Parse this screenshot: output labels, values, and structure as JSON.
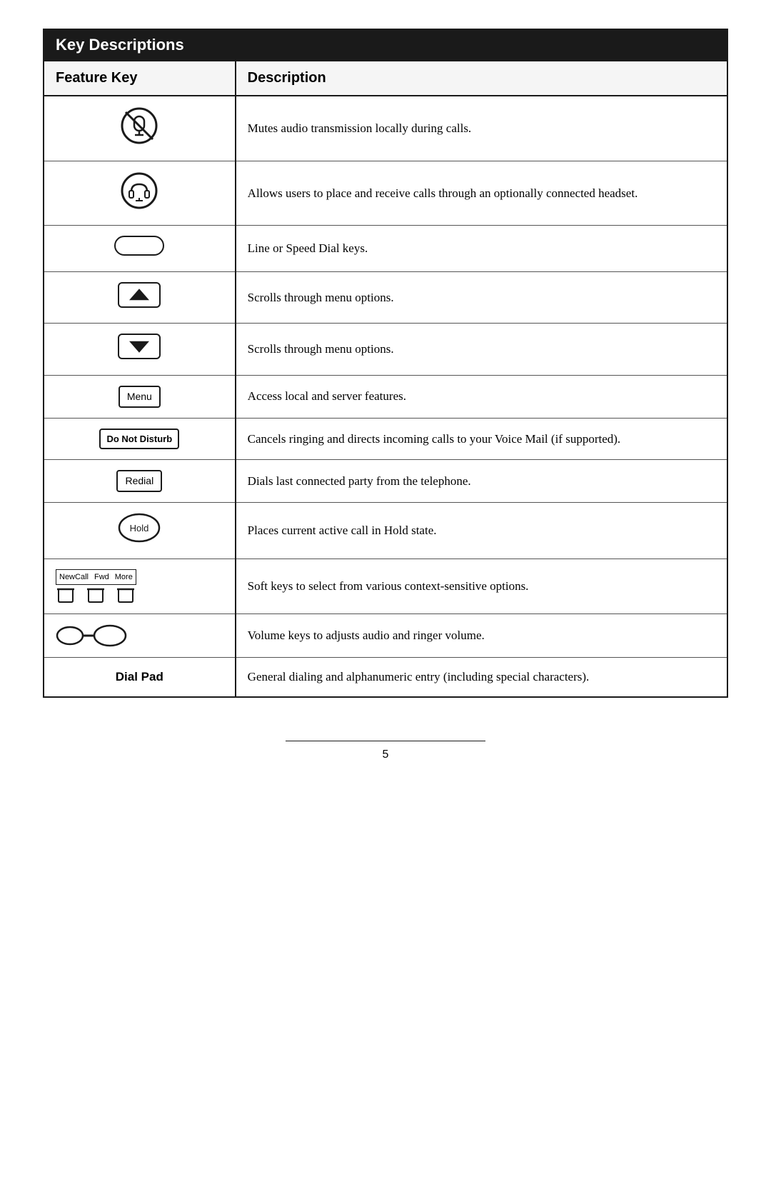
{
  "page": {
    "title": "Key Descriptions",
    "header": {
      "col1": "Feature Key",
      "col2": "Description"
    },
    "rows": [
      {
        "icon_type": "mute",
        "description": "Mutes audio transmission locally during calls."
      },
      {
        "icon_type": "headset",
        "description": "Allows users to place and receive calls through an optionally connected headset."
      },
      {
        "icon_type": "line_key",
        "description": "Line or Speed Dial keys."
      },
      {
        "icon_type": "scroll_up",
        "description": "Scrolls through menu options."
      },
      {
        "icon_type": "scroll_down",
        "description": "Scrolls through menu options."
      },
      {
        "icon_type": "menu",
        "description": "Access local and server features."
      },
      {
        "icon_type": "do_not_disturb",
        "description": "Cancels ringing and directs incoming calls to your Voice Mail (if supported)."
      },
      {
        "icon_type": "redial",
        "description": "Dials last connected party from the telephone."
      },
      {
        "icon_type": "hold",
        "description": "Places current active call in Hold state."
      },
      {
        "icon_type": "softkeys",
        "description": "Soft keys to select from various context-sensitive options."
      },
      {
        "icon_type": "volume",
        "description": "Volume keys to adjusts audio and ringer volume."
      },
      {
        "icon_type": "dial_pad",
        "description": "General dialing and alphanumeric entry (including special characters)."
      }
    ],
    "footer": {
      "page_number": "5"
    },
    "labels": {
      "menu_button": "Menu",
      "dnd_button": "Do Not Disturb",
      "redial_button": "Redial",
      "hold_button": "Hold",
      "softkey_newcall": "NewCall",
      "softkey_fwd": "Fwd",
      "softkey_more": "More"
    }
  }
}
